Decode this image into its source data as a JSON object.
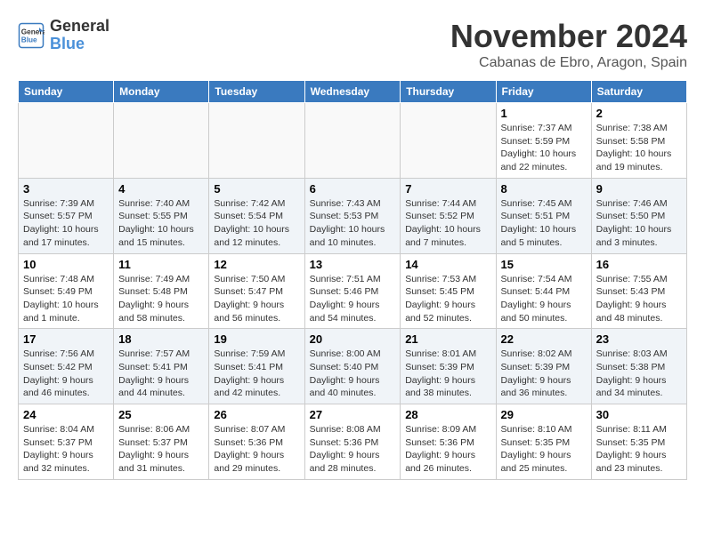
{
  "logo": {
    "line1": "General",
    "line2": "Blue"
  },
  "title": "November 2024",
  "location": "Cabanas de Ebro, Aragon, Spain",
  "days_of_week": [
    "Sunday",
    "Monday",
    "Tuesday",
    "Wednesday",
    "Thursday",
    "Friday",
    "Saturday"
  ],
  "weeks": [
    [
      {
        "day": "",
        "info": ""
      },
      {
        "day": "",
        "info": ""
      },
      {
        "day": "",
        "info": ""
      },
      {
        "day": "",
        "info": ""
      },
      {
        "day": "",
        "info": ""
      },
      {
        "day": "1",
        "info": "Sunrise: 7:37 AM\nSunset: 5:59 PM\nDaylight: 10 hours and 22 minutes."
      },
      {
        "day": "2",
        "info": "Sunrise: 7:38 AM\nSunset: 5:58 PM\nDaylight: 10 hours and 19 minutes."
      }
    ],
    [
      {
        "day": "3",
        "info": "Sunrise: 7:39 AM\nSunset: 5:57 PM\nDaylight: 10 hours and 17 minutes."
      },
      {
        "day": "4",
        "info": "Sunrise: 7:40 AM\nSunset: 5:55 PM\nDaylight: 10 hours and 15 minutes."
      },
      {
        "day": "5",
        "info": "Sunrise: 7:42 AM\nSunset: 5:54 PM\nDaylight: 10 hours and 12 minutes."
      },
      {
        "day": "6",
        "info": "Sunrise: 7:43 AM\nSunset: 5:53 PM\nDaylight: 10 hours and 10 minutes."
      },
      {
        "day": "7",
        "info": "Sunrise: 7:44 AM\nSunset: 5:52 PM\nDaylight: 10 hours and 7 minutes."
      },
      {
        "day": "8",
        "info": "Sunrise: 7:45 AM\nSunset: 5:51 PM\nDaylight: 10 hours and 5 minutes."
      },
      {
        "day": "9",
        "info": "Sunrise: 7:46 AM\nSunset: 5:50 PM\nDaylight: 10 hours and 3 minutes."
      }
    ],
    [
      {
        "day": "10",
        "info": "Sunrise: 7:48 AM\nSunset: 5:49 PM\nDaylight: 10 hours and 1 minute."
      },
      {
        "day": "11",
        "info": "Sunrise: 7:49 AM\nSunset: 5:48 PM\nDaylight: 9 hours and 58 minutes."
      },
      {
        "day": "12",
        "info": "Sunrise: 7:50 AM\nSunset: 5:47 PM\nDaylight: 9 hours and 56 minutes."
      },
      {
        "day": "13",
        "info": "Sunrise: 7:51 AM\nSunset: 5:46 PM\nDaylight: 9 hours and 54 minutes."
      },
      {
        "day": "14",
        "info": "Sunrise: 7:53 AM\nSunset: 5:45 PM\nDaylight: 9 hours and 52 minutes."
      },
      {
        "day": "15",
        "info": "Sunrise: 7:54 AM\nSunset: 5:44 PM\nDaylight: 9 hours and 50 minutes."
      },
      {
        "day": "16",
        "info": "Sunrise: 7:55 AM\nSunset: 5:43 PM\nDaylight: 9 hours and 48 minutes."
      }
    ],
    [
      {
        "day": "17",
        "info": "Sunrise: 7:56 AM\nSunset: 5:42 PM\nDaylight: 9 hours and 46 minutes."
      },
      {
        "day": "18",
        "info": "Sunrise: 7:57 AM\nSunset: 5:41 PM\nDaylight: 9 hours and 44 minutes."
      },
      {
        "day": "19",
        "info": "Sunrise: 7:59 AM\nSunset: 5:41 PM\nDaylight: 9 hours and 42 minutes."
      },
      {
        "day": "20",
        "info": "Sunrise: 8:00 AM\nSunset: 5:40 PM\nDaylight: 9 hours and 40 minutes."
      },
      {
        "day": "21",
        "info": "Sunrise: 8:01 AM\nSunset: 5:39 PM\nDaylight: 9 hours and 38 minutes."
      },
      {
        "day": "22",
        "info": "Sunrise: 8:02 AM\nSunset: 5:39 PM\nDaylight: 9 hours and 36 minutes."
      },
      {
        "day": "23",
        "info": "Sunrise: 8:03 AM\nSunset: 5:38 PM\nDaylight: 9 hours and 34 minutes."
      }
    ],
    [
      {
        "day": "24",
        "info": "Sunrise: 8:04 AM\nSunset: 5:37 PM\nDaylight: 9 hours and 32 minutes."
      },
      {
        "day": "25",
        "info": "Sunrise: 8:06 AM\nSunset: 5:37 PM\nDaylight: 9 hours and 31 minutes."
      },
      {
        "day": "26",
        "info": "Sunrise: 8:07 AM\nSunset: 5:36 PM\nDaylight: 9 hours and 29 minutes."
      },
      {
        "day": "27",
        "info": "Sunrise: 8:08 AM\nSunset: 5:36 PM\nDaylight: 9 hours and 28 minutes."
      },
      {
        "day": "28",
        "info": "Sunrise: 8:09 AM\nSunset: 5:36 PM\nDaylight: 9 hours and 26 minutes."
      },
      {
        "day": "29",
        "info": "Sunrise: 8:10 AM\nSunset: 5:35 PM\nDaylight: 9 hours and 25 minutes."
      },
      {
        "day": "30",
        "info": "Sunrise: 8:11 AM\nSunset: 5:35 PM\nDaylight: 9 hours and 23 minutes."
      }
    ]
  ]
}
